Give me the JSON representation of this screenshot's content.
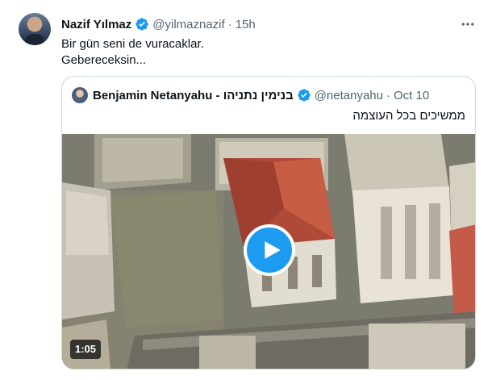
{
  "tweet": {
    "author_name": "Nazif Yılmaz",
    "handle": "@yilmaznazif",
    "separator": "·",
    "time": "15h",
    "lines": [
      "Bir gün seni de vuracaklar.",
      "Gebereceksin..."
    ]
  },
  "quoted": {
    "author_name": "Benjamin Netanyahu - בנימין נתניהו",
    "handle": "@netanyahu",
    "separator": "·",
    "time": "Oct 10",
    "text": "ממשיכים בכל העוצמה",
    "video_duration": "1:05"
  },
  "icons": {
    "verified": "verified-badge-icon",
    "more": "more-horizontal-icon",
    "play": "play-icon"
  },
  "colors": {
    "accent": "#1d9bf0",
    "muted_text": "#536471",
    "border": "#cfd9de"
  }
}
